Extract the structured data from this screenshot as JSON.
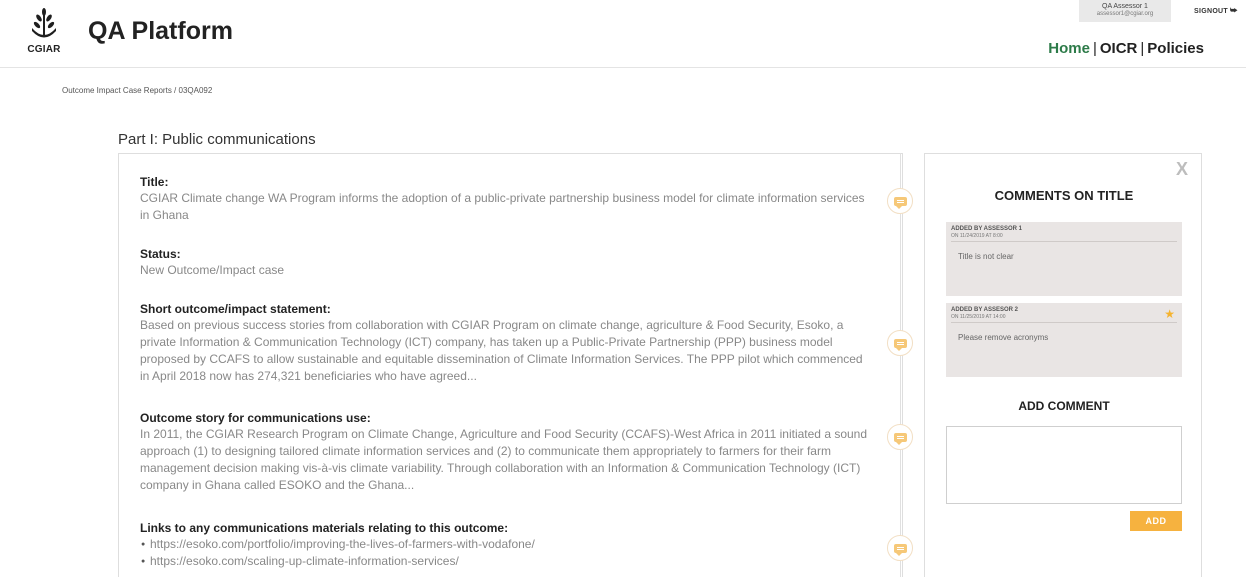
{
  "header": {
    "logo_text": "CGIAR",
    "app_title": "QA Platform",
    "user": {
      "name": "QA Assessor 1",
      "email": "assessor1@cgiar.org"
    },
    "signout_label": "SIGNOUT",
    "nav": [
      {
        "label": "Home",
        "active": true
      },
      {
        "label": "OICR",
        "active": false
      },
      {
        "label": "Policies",
        "active": false
      }
    ],
    "nav_separator": "|"
  },
  "breadcrumb": "Outcome Impact Case Reports / 03QA092",
  "section_title": "Part I: Public communications",
  "fields": {
    "title": {
      "label": "Title:",
      "text": "CGIAR Climate change WA Program informs the adoption of a public-private partnership business model for climate information services in Ghana"
    },
    "status": {
      "label": "Status:",
      "text": "New Outcome/Impact case"
    },
    "short_statement": {
      "label": "Short outcome/impact statement:",
      "text": "Based on previous success stories from collaboration with CGIAR Program on climate change, agriculture & Food Security, Esoko, a private Information & Communication Technology (ICT) company, has taken up a Public-Private Partnership (PPP) business model proposed by CCAFS to allow sustainable and equitable dissemination of Climate Information Services. The PPP pilot which commenced in April 2018 now has 274,321 beneficiaries who have agreed..."
    },
    "outcome_story": {
      "label": "Outcome story for communications use:",
      "text": "In 2011, the CGIAR Research Program on Climate Change, Agriculture and Food Security (CCAFS)-West Africa in 2011 initiated a sound approach (1) to designing tailored climate information services and (2) to communicate them appropriately to farmers for their farm management decision making vis-à-vis climate variability. Through collaboration with an Information & Communication Technology (ICT) company in Ghana called ESOKO and the Ghana..."
    },
    "links": {
      "label": "Links to any communications materials relating to this outcome:",
      "items": [
        "https://esoko.com/portfolio/improving-the-lives-of-farmers-with-vodafone/",
        "https://esoko.com/scaling-up-climate-information-services/"
      ]
    }
  },
  "comments_panel": {
    "close_label": "X",
    "title": "COMMENTS ON TITLE",
    "comments": [
      {
        "author": "ADDED BY ASSESSOR 1",
        "date": "ON 11/24/2019 AT 8:00",
        "text": "Title is not clear",
        "starred": false
      },
      {
        "author": "ADDED BY ASSESOR 2",
        "date": "ON 11/25/2019 AT 14:00",
        "text": "Please remove acronyms",
        "starred": true
      }
    ],
    "add_title": "ADD COMMENT",
    "add_placeholder": "",
    "add_button": "ADD"
  },
  "colors": {
    "nav_active": "#2d7b49",
    "accent_orange": "#f6b23f",
    "comment_card_bg": "#e9e5e4"
  },
  "icons": {
    "logo": "cgiar-wheat-logo",
    "signout": "signout-icon",
    "comment": "comment-bubble-icon",
    "star": "star-icon",
    "close": "close-icon"
  }
}
